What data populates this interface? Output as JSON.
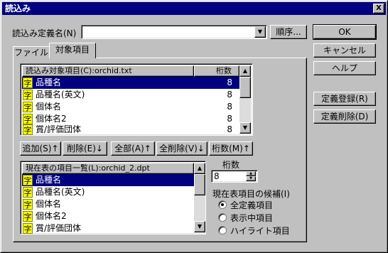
{
  "window": {
    "title": "読込み",
    "close_glyph": "X"
  },
  "definition": {
    "label": "読込み定義名(N)",
    "value": "",
    "order_button": "順序..."
  },
  "tabs": [
    {
      "label": "ファイル"
    },
    {
      "label": "対象項目"
    }
  ],
  "target_list": {
    "header_name": "読込み対象項目(C):orchid.txt",
    "header_count": "桁数",
    "rows": [
      {
        "icon": "字",
        "name": "品種名",
        "count": "8"
      },
      {
        "icon": "字",
        "name": "品種名(英文)",
        "count": "8"
      },
      {
        "icon": "字",
        "name": "個体名",
        "count": "8"
      },
      {
        "icon": "字",
        "name": "個体名2",
        "count": "8"
      },
      {
        "icon": "字",
        "name": "賞/評価団体",
        "count": "8"
      }
    ]
  },
  "list_buttons": {
    "add": "追加(S)↑",
    "remove": "削除(E)↓",
    "all": "全部(A)↑",
    "remove_all": "全削除(V)↓",
    "digits": "桁数(M)↑"
  },
  "current_list": {
    "header_name": "現在表の項目一覧(L):orchid_2.dpt",
    "rows": [
      {
        "icon": "字",
        "name": "品種名"
      },
      {
        "icon": "字",
        "name": "品種名(英文)"
      },
      {
        "icon": "字",
        "name": "個体名"
      },
      {
        "icon": "字",
        "name": "個体名2"
      },
      {
        "icon": "字",
        "name": "賞/評価団体"
      }
    ]
  },
  "digits": {
    "label": "桁数",
    "value": "8"
  },
  "candidates": {
    "label": "現在表項目の候補(I)",
    "options": [
      {
        "label": "全定義項目",
        "selected": true
      },
      {
        "label": "表示中項目",
        "selected": false
      },
      {
        "label": "ハイライト項目",
        "selected": false
      }
    ]
  },
  "side_buttons": {
    "ok": "OK",
    "cancel": "キャンセル",
    "help": "ヘルプ",
    "register": "定義登録(R)",
    "delete": "定義削除(D)"
  },
  "colors": {
    "title_bar": "#000080",
    "selection": "#000080",
    "face": "#c0c0c0",
    "type_icon": "#ffff00"
  }
}
